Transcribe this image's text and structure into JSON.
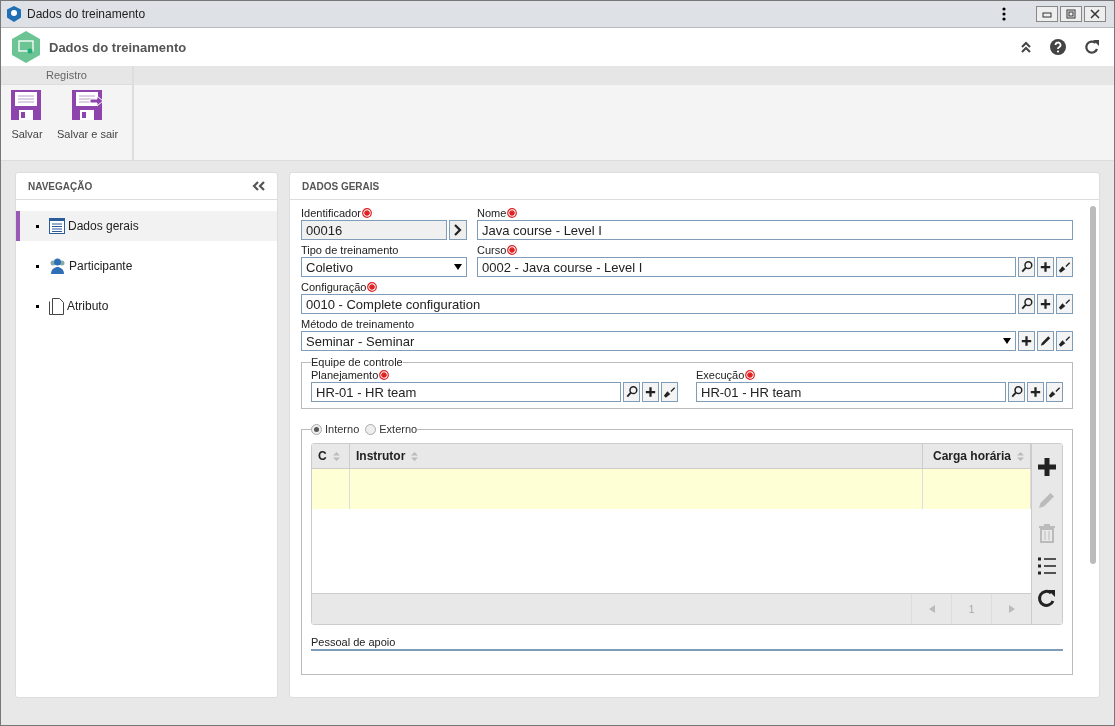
{
  "window": {
    "title": "Dados do treinamento"
  },
  "header": {
    "title": "Dados do treinamento"
  },
  "ribbon": {
    "group_label": "Registro",
    "buttons": [
      {
        "label": "Salvar",
        "kind": "save"
      },
      {
        "label": "Salvar e sair",
        "kind": "save-exit"
      }
    ]
  },
  "navigation": {
    "title": "NAVEGAÇÃO",
    "items": [
      {
        "label": "Dados gerais",
        "kind": "list",
        "selected": true
      },
      {
        "label": "Participante",
        "kind": "people",
        "selected": false
      },
      {
        "label": "Atributo",
        "kind": "page",
        "selected": false
      }
    ]
  },
  "section": {
    "title": "DADOS GERAIS"
  },
  "fields": {
    "identificador": {
      "label": "Identificador",
      "required": true,
      "value": "00016",
      "readonly": true
    },
    "nome": {
      "label": "Nome",
      "required": true,
      "value": "Java course - Level I"
    },
    "tipo": {
      "label": "Tipo de treinamento",
      "value": "Coletivo",
      "kind": "select"
    },
    "curso": {
      "label": "Curso",
      "required": true,
      "value": "0002 - Java course - Level I",
      "actions": [
        {
          "kind": "search"
        },
        {
          "kind": "add"
        },
        {
          "kind": "clear"
        }
      ]
    },
    "configuracao": {
      "label": "Configuração",
      "required": true,
      "value": "0010 - Complete configuration",
      "actions": [
        {
          "kind": "search"
        },
        {
          "kind": "add"
        },
        {
          "kind": "clear"
        }
      ]
    },
    "metodo": {
      "label": "Método de treinamento",
      "value": "Seminar - Seminar",
      "kind": "select",
      "actions": [
        {
          "kind": "add"
        },
        {
          "kind": "edit"
        },
        {
          "kind": "clear"
        }
      ]
    }
  },
  "control_team": {
    "legend": "Equipe de controle",
    "fields": [
      {
        "label": "Planejamento",
        "required": true,
        "value": "HR-01 - HR team",
        "actions": [
          {
            "kind": "search"
          },
          {
            "kind": "add"
          },
          {
            "kind": "clear"
          }
        ]
      },
      {
        "label": "Execução",
        "required": true,
        "value": "HR-01 - HR team",
        "actions": [
          {
            "kind": "search"
          },
          {
            "kind": "add"
          },
          {
            "kind": "clear"
          }
        ]
      }
    ]
  },
  "instructor_type": {
    "options": [
      {
        "label": "Interno",
        "selected": true
      },
      {
        "label": "Externo",
        "selected": false
      }
    ]
  },
  "instructors_table": {
    "columns": [
      {
        "label": "C"
      },
      {
        "label": "Instrutor"
      },
      {
        "label": "Carga horária"
      }
    ],
    "rows": [
      {
        "selected": true
      }
    ],
    "page": "1",
    "tools": [
      {
        "kind": "add",
        "disabled": false
      },
      {
        "kind": "edit",
        "disabled": true
      },
      {
        "kind": "delete",
        "disabled": true
      },
      {
        "kind": "list",
        "disabled": false
      },
      {
        "kind": "refresh",
        "disabled": false
      }
    ]
  },
  "support_staff": {
    "label": "Pessoal de apoio"
  }
}
